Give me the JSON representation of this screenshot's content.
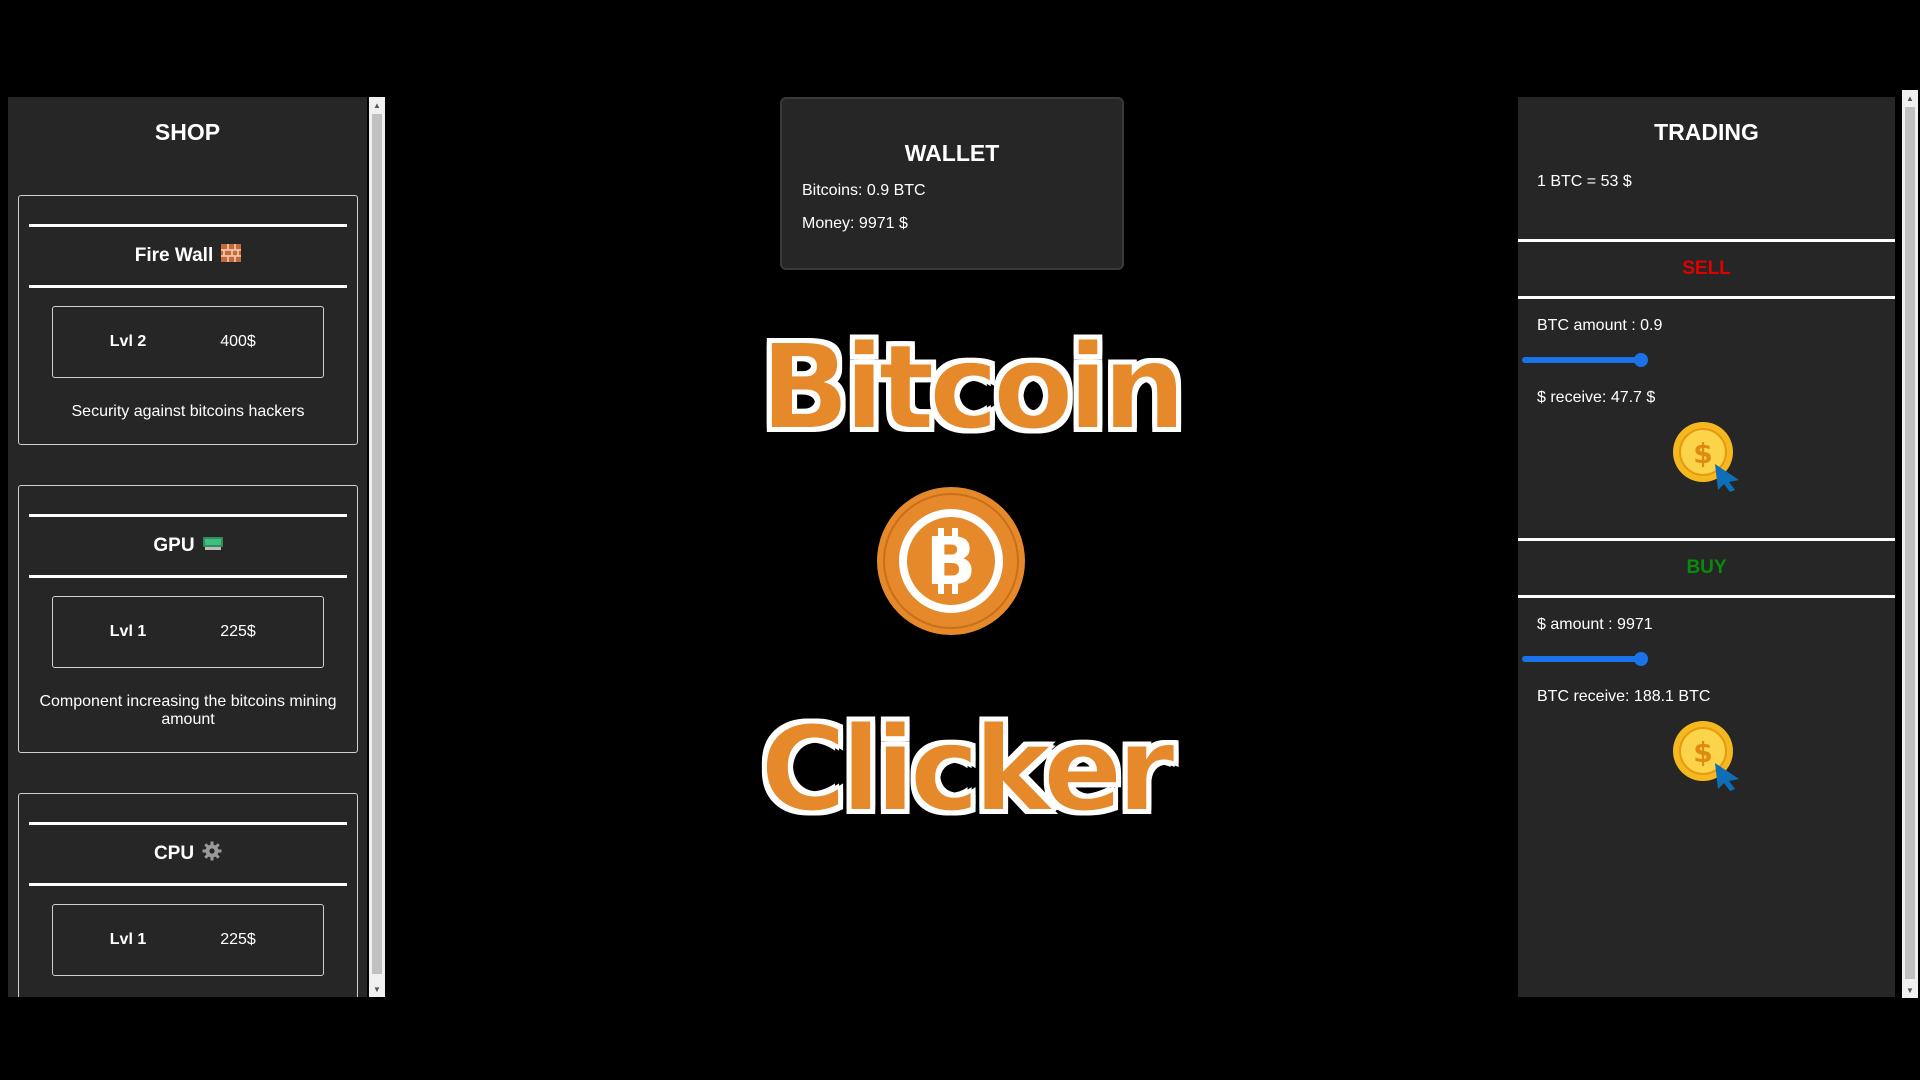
{
  "shop": {
    "title": "SHOP",
    "items": [
      {
        "name": "Fire Wall",
        "icon": "brick-wall-icon",
        "level": "Lvl 2",
        "price": "400$",
        "description": "Security against bitcoins hackers"
      },
      {
        "name": "GPU",
        "icon": "gpu-icon",
        "level": "Lvl 1",
        "price": "225$",
        "description": "Component increasing the bitcoins mining amount"
      },
      {
        "name": "CPU",
        "icon": "gear-icon",
        "level": "Lvl 1",
        "price": "225$",
        "description": ""
      }
    ]
  },
  "wallet": {
    "title": "WALLET",
    "bitcoins": "Bitcoins: 0.9 BTC",
    "money": "Money: 9971 $"
  },
  "logo": {
    "top_word": "Bitcoin",
    "bottom_word": "Clicker",
    "coin_icon": "bitcoin-coin-icon",
    "color": "#e5892a"
  },
  "trading": {
    "title": "TRADING",
    "rate": "1 BTC = 53 $",
    "sell": {
      "title": "SELL",
      "amount_label": "BTC amount : 0.9",
      "slider_fraction": 1.0,
      "receive_label": "$ receive: 47.7 $",
      "button_icon": "coin-click-icon"
    },
    "buy": {
      "title": "BUY",
      "amount_label": "$ amount : 9971",
      "slider_fraction": 1.0,
      "receive_label": "BTC receive: 188.1 BTC",
      "button_icon": "coin-click-icon"
    }
  },
  "colors": {
    "panel_bg": "#262626",
    "sell": "#e00000",
    "buy": "#0a8a0a",
    "slider": "#1a73e8",
    "bitcoin_orange": "#e5892a"
  }
}
